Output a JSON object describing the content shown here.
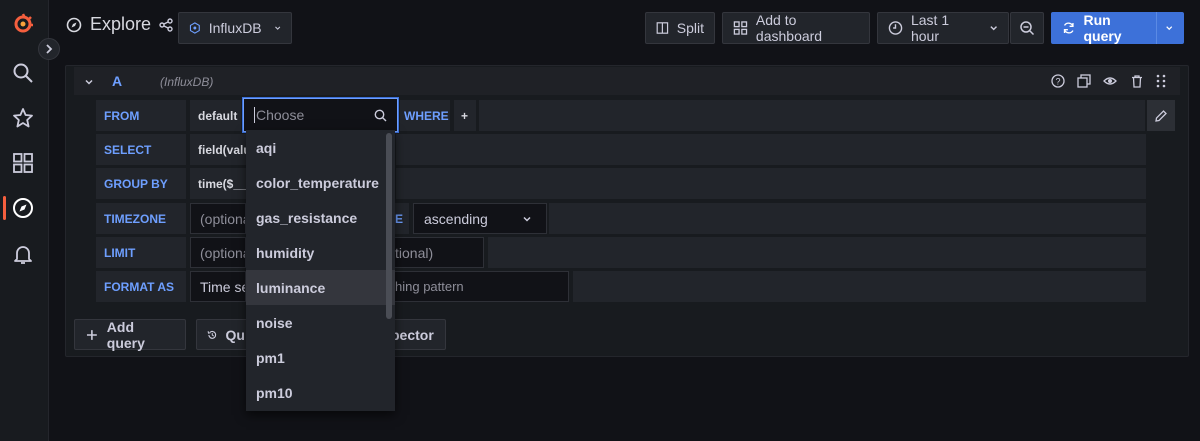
{
  "header": {
    "title": "Explore",
    "datasource": "InfluxDB",
    "split_label": "Split",
    "add_dashboard_label": "Add to dashboard",
    "time_range_label": "Last 1 hour",
    "run_query_label": "Run query"
  },
  "query": {
    "ref_id": "A",
    "datasource_hint": "(InfluxDB)",
    "rows": {
      "from_label": "FROM",
      "from_policy": "default",
      "from_placeholder": "Choose",
      "where_label": "WHERE",
      "where_add": "+",
      "select_label": "SELECT",
      "select_value": "field(valu",
      "groupby_label": "GROUP BY",
      "groupby_value": "time($__i",
      "timezone_label": "TIMEZONE",
      "timezone_placeholder": "(optiona",
      "orderby_label_partial": "E",
      "order_value": "ascending",
      "limit_label": "LIMIT",
      "limit_placeholder": "(optiona",
      "slimit_placeholder": "tional)",
      "format_label": "FORMAT AS",
      "format_value": "Time se",
      "alias_placeholder": "hing pattern"
    },
    "measurements": [
      "aqi",
      "color_temperature",
      "gas_resistance",
      "humidity",
      "luminance",
      "noise",
      "pm1",
      "pm10"
    ],
    "highlighted": "luminance"
  },
  "footer": {
    "add_query_label": "Add query",
    "history_label_partial": "Qu",
    "inspector_label_partial": "pector"
  },
  "colors": {
    "accent": "#6e9fff",
    "primary_button": "#3d71d9",
    "grafana_logo": "#f55f3e"
  }
}
